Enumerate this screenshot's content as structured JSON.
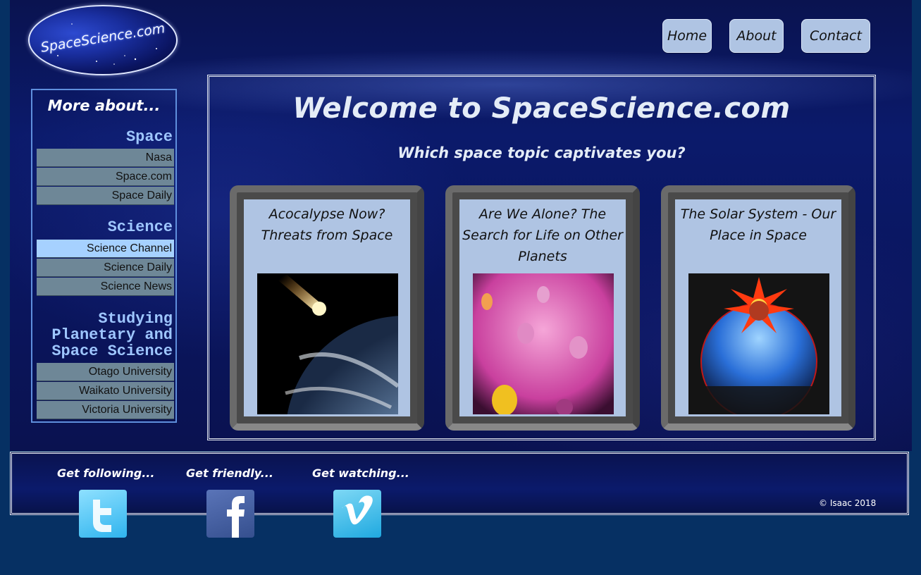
{
  "logo": {
    "text": "SpaceScience.com"
  },
  "nav": [
    {
      "label": "Home"
    },
    {
      "label": "About"
    },
    {
      "label": "Contact"
    }
  ],
  "sidebar": {
    "heading": "More about...",
    "sections": [
      {
        "title": "Space",
        "links": [
          "Nasa",
          "Space.com",
          "Space Daily"
        ]
      },
      {
        "title": "Science",
        "links": [
          "Science Channel",
          "Science Daily",
          "Science News"
        ]
      },
      {
        "title_lines": [
          "Studying",
          "Planetary and",
          "Space Science"
        ],
        "links": [
          "Otago University",
          "Waikato University",
          "Victoria University"
        ]
      }
    ],
    "active_link": "Science Channel"
  },
  "main": {
    "title": "Welcome to SpaceScience.com",
    "subtitle": "Which space topic captivates you?",
    "cards": [
      {
        "title": "Acocalypse Now? Threats from Space",
        "image": "asteroid-earth"
      },
      {
        "title": "Are We Alone? The Search for Life on Other Planets",
        "image": "aliens"
      },
      {
        "title": "The Solar System - Our Place in Space",
        "image": "solar-system"
      }
    ]
  },
  "footer": {
    "social": [
      {
        "label": "Get following...",
        "icon": "twitter-icon"
      },
      {
        "label": "Get friendly...",
        "icon": "facebook-icon"
      },
      {
        "label": "Get watching...",
        "icon": "vimeo-icon"
      }
    ],
    "copyright": "© Isaac 2018"
  },
  "colors": {
    "page_bg": "#063063",
    "button_bg": "#afc4e3",
    "sidebar_link_bg": "#6e8797",
    "sidebar_active_bg": "#a6d1ff",
    "heading_blue": "#9ec6ff"
  }
}
